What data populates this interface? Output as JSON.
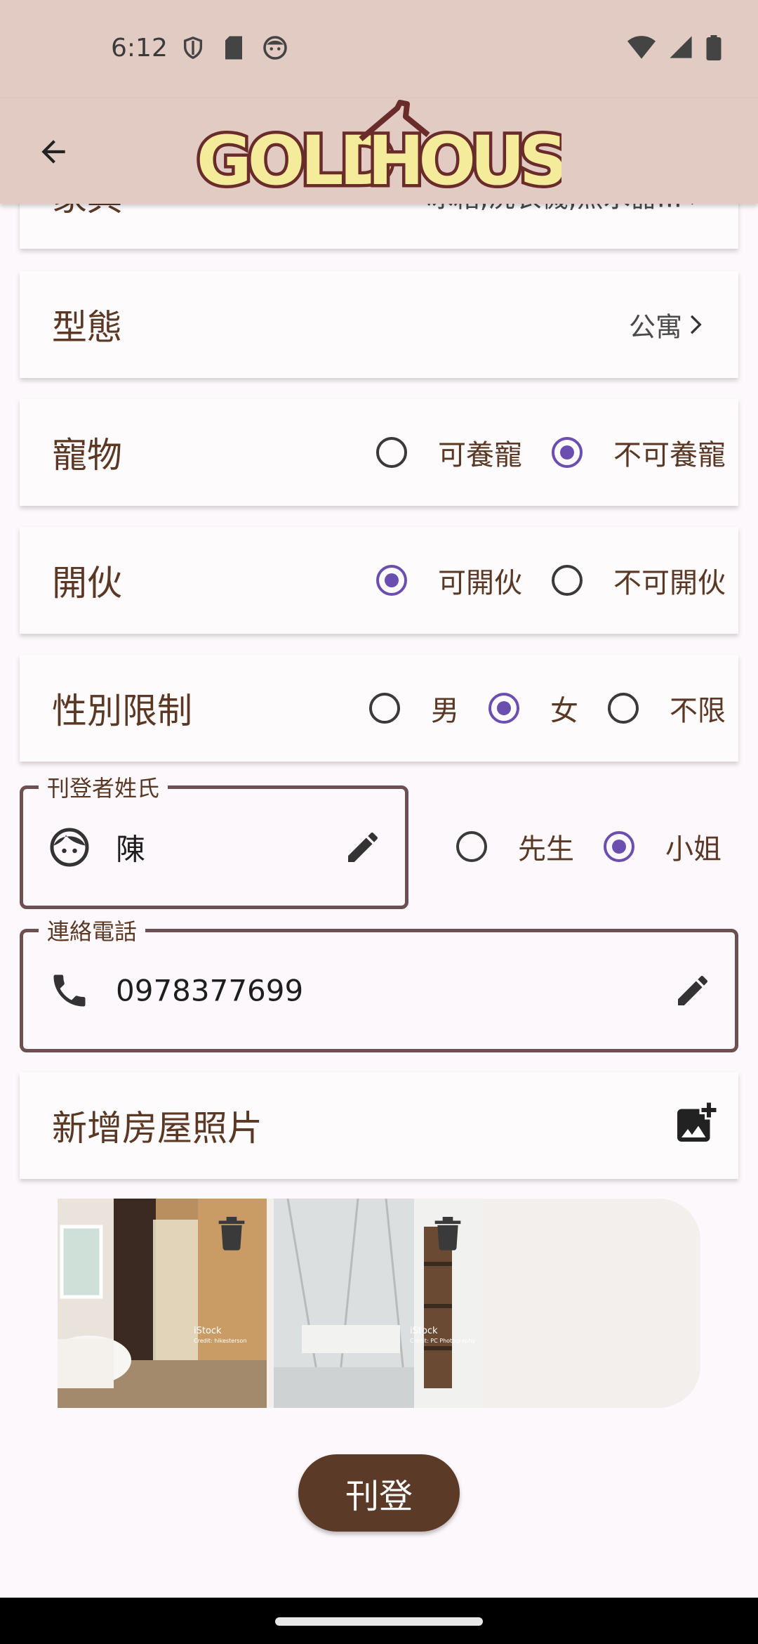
{
  "status": {
    "time": "6:12"
  },
  "appbar": {
    "logo_left": "GOLD",
    "logo_right": "HOUSE"
  },
  "rows": {
    "furniture": {
      "label": "家具",
      "value": "冰箱,洗衣機,熱水器..."
    },
    "type": {
      "label": "型態",
      "value": "公寓"
    },
    "pet": {
      "label": "寵物",
      "options": [
        "可養寵",
        "不可養寵"
      ],
      "selected": 1
    },
    "cook": {
      "label": "開伙",
      "options": [
        "可開伙",
        "不可開伙"
      ],
      "selected": 0
    },
    "gender": {
      "label": "性別限制",
      "options": [
        "男",
        "女",
        "不限"
      ],
      "selected": 1
    }
  },
  "poster": {
    "label": "刊登者姓氏",
    "value": "陳",
    "title_options": [
      "先生",
      "小姐"
    ],
    "title_selected": 1
  },
  "phone": {
    "label": "連絡電話",
    "value": "0978377699"
  },
  "photos": {
    "label": "新增房屋照片",
    "items": [
      {
        "watermark": "iStock",
        "credit": "Credit: hikesterson"
      },
      {
        "watermark": "iStock",
        "credit": "Credit: PC Photography"
      }
    ]
  },
  "submit": {
    "label": "刊登"
  },
  "colors": {
    "accent": "#6b4fb0",
    "brand_brown": "#5c3a28",
    "bar_bg": "#e2cbc3"
  }
}
